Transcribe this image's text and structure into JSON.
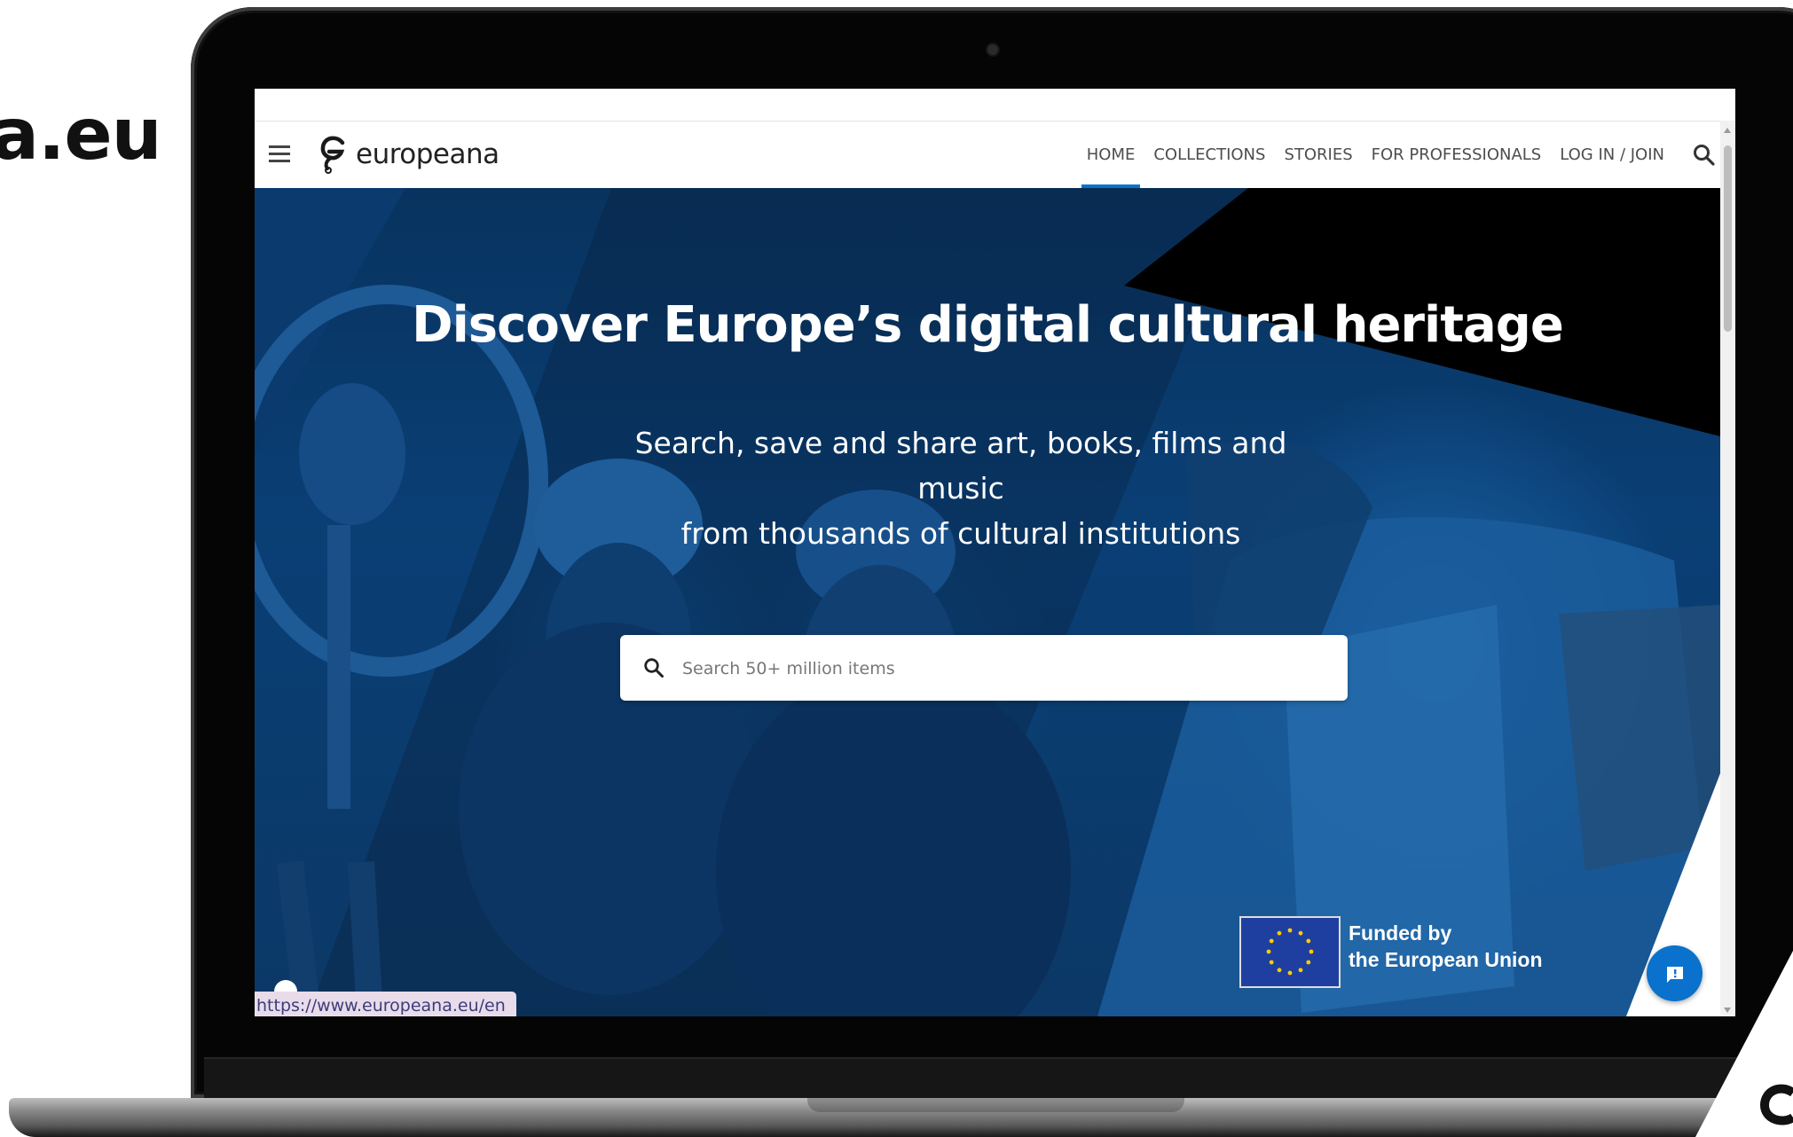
{
  "slide": {
    "title_fragment": "a.eu"
  },
  "browser": {
    "status_url": "https://www.europeana.eu/en"
  },
  "site": {
    "logo_text": "europeana",
    "nav": [
      {
        "label": "HOME",
        "active": true
      },
      {
        "label": "COLLECTIONS",
        "active": false
      },
      {
        "label": "STORIES",
        "active": false
      },
      {
        "label": "FOR PROFESSIONALS",
        "active": false
      },
      {
        "label": "LOG IN / JOIN",
        "active": false
      }
    ],
    "hero": {
      "title": "Discover Europe’s digital cultural heritage",
      "subtitle_line1": "Search, save and share art, books, films and music",
      "subtitle_line2": "from thousands of cultural institutions",
      "search_placeholder": "Search 50+ million items"
    },
    "funding": {
      "line1": "Funded by",
      "line2": "the European Union"
    }
  },
  "colors": {
    "accent": "#0a72cc",
    "hero_overlay": "#0a3f75",
    "eu_blue": "#1f3fa0",
    "eu_star": "#ffcc00"
  },
  "icons": [
    "hamburger-icon",
    "europeana-logo-icon",
    "search-icon",
    "chat-icon",
    "eu-flag-icon"
  ]
}
